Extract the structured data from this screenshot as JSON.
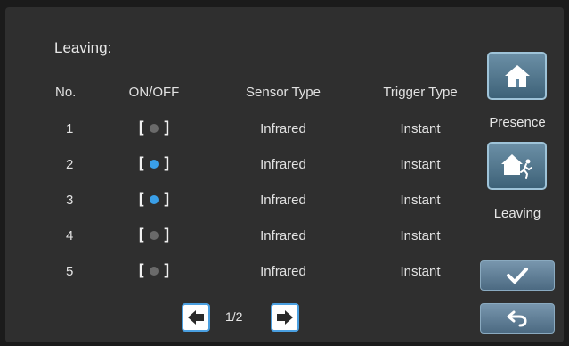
{
  "screen": {
    "title": "Leaving:"
  },
  "table": {
    "headers": {
      "no": "No.",
      "onoff": "ON/OFF",
      "sensor": "Sensor Type",
      "trigger": "Trigger Type"
    },
    "rows": [
      {
        "no": "1",
        "on": false,
        "sensor": "Infrared",
        "trigger": "Instant"
      },
      {
        "no": "2",
        "on": true,
        "sensor": "Infrared",
        "trigger": "Instant"
      },
      {
        "no": "3",
        "on": true,
        "sensor": "Infrared",
        "trigger": "Instant"
      },
      {
        "no": "4",
        "on": false,
        "sensor": "Infrared",
        "trigger": "Instant"
      },
      {
        "no": "5",
        "on": false,
        "sensor": "Infrared",
        "trigger": "Instant"
      }
    ]
  },
  "pager": {
    "indicator": "1/2",
    "prev_icon": "arrow-left-icon",
    "next_icon": "arrow-right-icon"
  },
  "side": {
    "presence_label": "Presence",
    "leaving_label": "Leaving",
    "presence_icon": "house-icon",
    "leaving_icon": "house-running-person-icon"
  },
  "actions": {
    "confirm_icon": "checkmark-icon",
    "back_icon": "back-arrow-icon"
  },
  "colors": {
    "on_dot": "#3a9fe8",
    "off_dot": "#6a6a6a",
    "background": "#2f2f2f"
  }
}
